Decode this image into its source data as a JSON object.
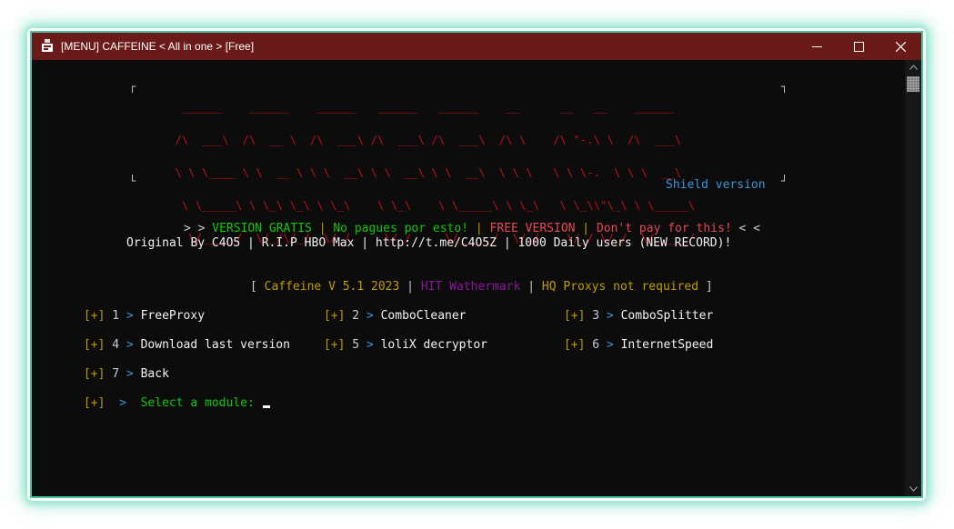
{
  "window": {
    "title": "[MENU] CAFFEINE < All in one > [Free]"
  },
  "banner": {
    "art": [
      "  ______    ______    ______   ______   ______    __      __   __    ______",
      " /\\  ___\\  /\\  __ \\  /\\  ___\\ /\\  ___\\ /\\  ___\\  /\\ \\    /\\ \"-.\\ \\  /\\  ___\\",
      " \\ \\ \\____ \\ \\  __ \\ \\ \\  __\\ \\ \\  __\\ \\ \\  __\\  \\ \\ \\   \\ \\ \\-.  \\ \\ \\  __\\",
      "  \\ \\_____\\ \\ \\_\\ \\_\\ \\ \\_\\    \\ \\_\\    \\ \\_____\\ \\ \\_\\   \\ \\_\\\\\"\\_\\ \\ \\_____\\",
      "   \\/_____/  \\/_/\\/_/  \\/_/     \\/_/     \\/_____/  \\/_/    \\/_/ \\/_/  \\/_____/"
    ],
    "shield": "Shield version"
  },
  "version_line": {
    "prefix": "> >",
    "gratis": "VERSION GRATIS",
    "sep": "|",
    "no_pagues": "No pagues por esto!",
    "free": "FREE VERSION",
    "dont_pay": "Don't pay for this!",
    "suffix": "< <"
  },
  "credits_line": "Original By C4O5 | R.I.P HBO Max | http://t.me/C4O5Z | 1000 Daily users (NEW RECORD)!",
  "info_line": {
    "open": "[",
    "caffeine": "Caffeine V 5.1 2023",
    "sep": "|",
    "hit": "HIT Wathermark",
    "hq": "HQ Proxys not required",
    "close": "]"
  },
  "menu": {
    "bracket": "[+]",
    "chevron": ">",
    "items": [
      {
        "num": "1",
        "label": "FreeProxy"
      },
      {
        "num": "2",
        "label": "ComboCleaner"
      },
      {
        "num": "3",
        "label": "ComboSplitter"
      },
      {
        "num": "4",
        "label": "Download last version"
      },
      {
        "num": "5",
        "label": "loliX decryptor"
      },
      {
        "num": "6",
        "label": "InternetSpeed"
      },
      {
        "num": "7",
        "label": "Back"
      }
    ]
  },
  "prompt": {
    "bracket": "[+]",
    "chevron": ">",
    "label": "Select a module:"
  }
}
